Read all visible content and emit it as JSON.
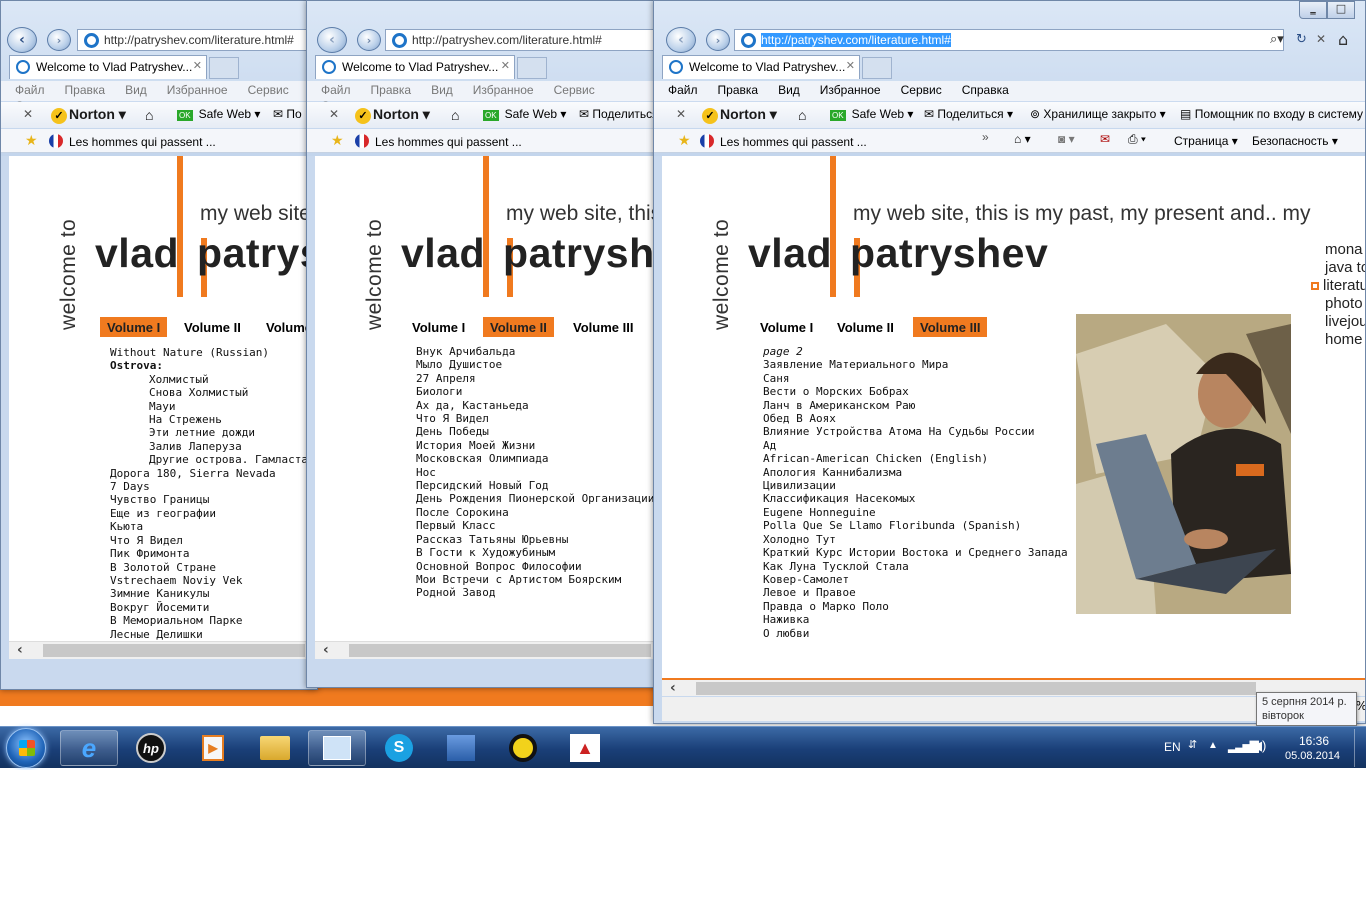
{
  "address_url": "http://patryshev.com/literature.html#",
  "tab_title": "Welcome to Vlad Patryshev...",
  "menu": [
    "Файл",
    "Правка",
    "Вид",
    "Избранное",
    "Сервис",
    "Справка"
  ],
  "toolbar": {
    "norton": "Norton",
    "safe_web": "Safe Web",
    "share": "Поделиться",
    "vault": "Хранилище закрыто",
    "login_assistant": "Помощник по входу в систему"
  },
  "favorites": {
    "item": "Les hommes qui passent ...",
    "page_menu": "Страница",
    "safety_menu": "Безопасность"
  },
  "site": {
    "welcome": "welcome to",
    "name_vlad": "vlad",
    "name_patryshev": "patryshev",
    "tagline": "my web site, this is my past, my present and.. my",
    "volumes": [
      "Volume I",
      "Volume II",
      "Volume III"
    ],
    "sidenav": [
      "mona",
      "java to",
      "literatu",
      "photo",
      "livejou",
      "home"
    ]
  },
  "win1": {
    "list": [
      {
        "t": "Without Nature (Russian)",
        "s": ""
      },
      {
        "t": "Ostrova:",
        "s": "b"
      },
      {
        "t": "Холмистый",
        "s": "ind"
      },
      {
        "t": "Снова Холмистый",
        "s": "ind"
      },
      {
        "t": "Мауи",
        "s": "ind"
      },
      {
        "t": "На Стрежень",
        "s": "ind"
      },
      {
        "t": "Эти летние дожди",
        "s": "ind"
      },
      {
        "t": "Залив Лаперуза",
        "s": "ind"
      },
      {
        "t": "Другие острова. Гамластан.",
        "s": "ind"
      },
      {
        "t": "Дорога 180, Sierra Nevada",
        "s": ""
      },
      {
        "t": "7 Days",
        "s": ""
      },
      {
        "t": "Чувство Границы",
        "s": ""
      },
      {
        "t": "Еще из географии",
        "s": ""
      },
      {
        "t": "Кьюта",
        "s": ""
      },
      {
        "t": "Что Я Видел",
        "s": ""
      },
      {
        "t": "Пик Фримонта",
        "s": ""
      },
      {
        "t": "В Золотой Стране",
        "s": ""
      },
      {
        "t": "Vstrechaem Noviy Vek",
        "s": ""
      },
      {
        "t": "Зимние Каникулы",
        "s": ""
      },
      {
        "t": "Вокруг Йосемити",
        "s": ""
      },
      {
        "t": "В Мемориальном Парке",
        "s": ""
      },
      {
        "t": "Лесные Делишки",
        "s": ""
      }
    ]
  },
  "win2": {
    "list": [
      "Внук Арчибальда",
      "Мыло Душистое",
      "27 Апреля",
      "Биологи",
      "Ах да, Кастаньеда",
      "Что Я Видел",
      "День Победы",
      "История Моей Жизни",
      "Московская Олимпиада",
      "Нос",
      "Персидский Новый Год",
      "День Рождения Пионерской Организации",
      "После Сорокина",
      "Первый Класс",
      "Рассказ Татьяны Юрьевны",
      "В Гости к Художубиным",
      "Основной Вопрос Философии",
      "Мои Встречи с Артистом Боярским",
      "Родной Завод"
    ]
  },
  "win3": {
    "page_label": "page 2",
    "list": [
      "Заявление Материального Мира",
      "Саня",
      "Вести о Морских Бобрах",
      "Ланч в Американском Раю",
      "Обед В Аоях",
      "Влияние Устройства Атома На Судьбы России",
      "Ад",
      "African-American Chicken (English)",
      "Апология Каннибализма",
      "Цивилизации",
      "Классификация Насекомых",
      "Eugene Honneguine",
      "Polla Que Se Llamo Floribunda (Spanish)",
      "Холодно Тут",
      "Краткий Курс Истории Востока и Среднего Запада",
      "Как Луна Тусклой Стала",
      "Ковер-Самолет",
      "Левое и Правое",
      "Правда о Марко Поло",
      "Наживка",
      "О любви"
    ]
  },
  "tray": {
    "lang": "EN",
    "time": "16:36",
    "date": "05.08.2014",
    "tooltip_line1": "5 серпня 2014 р.",
    "tooltip_line2": "вівторок",
    "status_pct": "%"
  },
  "taskbar_apps": [
    "internet-explorer",
    "hp",
    "media-player",
    "explorer",
    "control-panel",
    "skype",
    "network",
    "quicktime",
    "freshtel"
  ]
}
